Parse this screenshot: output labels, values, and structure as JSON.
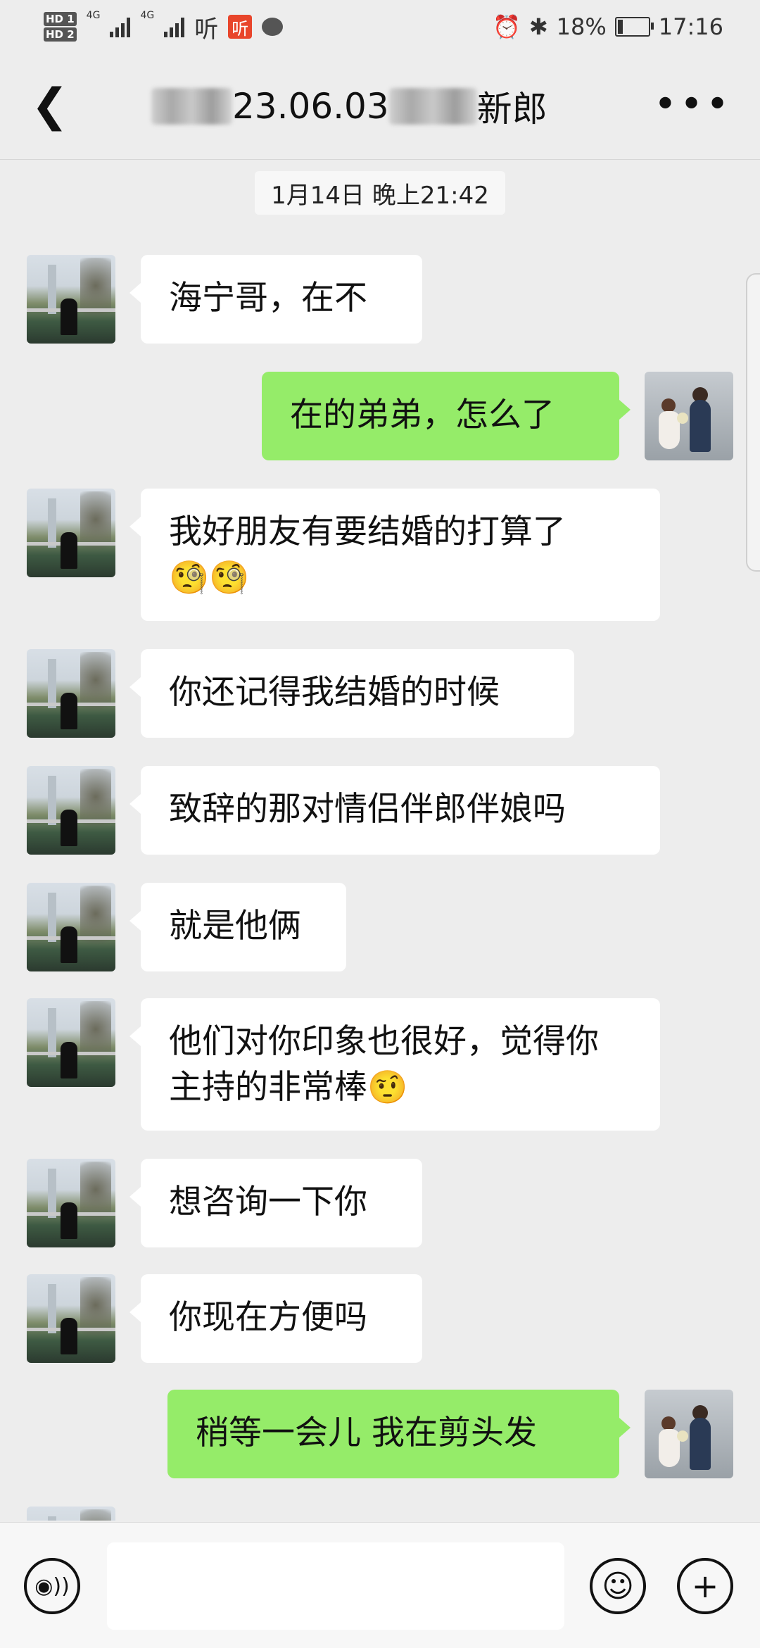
{
  "status_bar": {
    "hd1": "HD 1",
    "hd2": "HD 2",
    "net1": "4G",
    "net2": "4G",
    "app_ting": "听",
    "app_ting_badge": "听",
    "battery_percent": "18%",
    "battery_level": 0.18,
    "time": "17:16"
  },
  "header": {
    "title_visible": "23.06.03",
    "title_suffix": "新郎"
  },
  "timestamp": "1月14日 晚上21:42",
  "messages": [
    {
      "side": "left",
      "text": "海宁哥，在不"
    },
    {
      "side": "right",
      "text": "在的弟弟，怎么了"
    },
    {
      "side": "left",
      "text": "我好朋友有要结婚的打算了",
      "emoji": "🧐🧐"
    },
    {
      "side": "left",
      "text": "你还记得我结婚的时候"
    },
    {
      "side": "left",
      "text": "致辞的那对情侣伴郎伴娘吗"
    },
    {
      "side": "left",
      "text": "就是他俩"
    },
    {
      "side": "left",
      "text": "他们对你印象也很好，觉得你主持的非常棒",
      "emoji": "🤨"
    },
    {
      "side": "left",
      "text": "想咨询一下你"
    },
    {
      "side": "left",
      "text": "你现在方便吗"
    },
    {
      "side": "right",
      "text": "稍等一会儿 我在剪头发"
    }
  ],
  "input_bar": {
    "voice_icon": "voice-icon",
    "emoji_icon": "emoji-icon",
    "plus_icon": "plus-icon",
    "input_value": ""
  }
}
